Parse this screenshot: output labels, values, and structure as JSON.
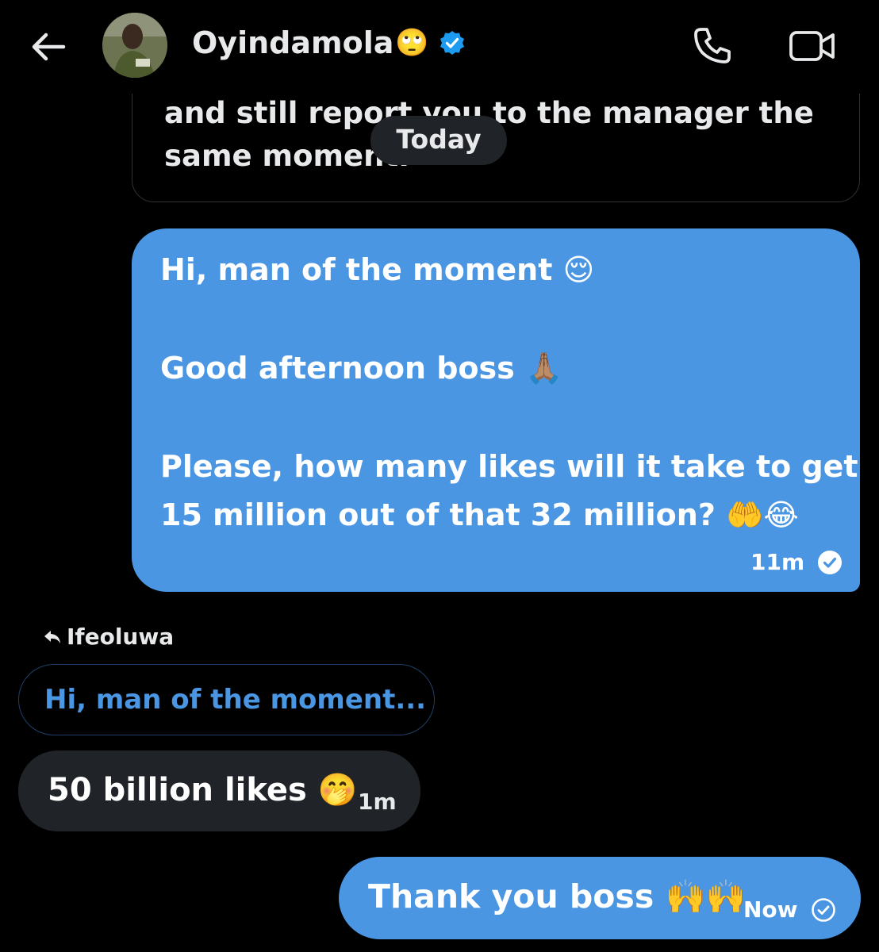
{
  "header": {
    "name": "Oyindamola",
    "name_emoji": "🙄"
  },
  "previous_message": {
    "line1": "and still report you to the manager the",
    "line2": "same moment."
  },
  "date_divider": "Today",
  "messages": [
    {
      "direction": "sent",
      "lines": [
        "Hi, man of the moment 😌",
        "Good afternoon boss 🙏🏽",
        "Please, how many likes will it take to get",
        "15 million out of that 32 million? 🤲😂"
      ],
      "time": "11m",
      "status": "read"
    },
    {
      "direction": "received",
      "reply_to_name": "Ifeoluwa",
      "quoted_text": "Hi, man of the moment...",
      "text": "50 billion likes 🤭",
      "time": "1m"
    },
    {
      "direction": "sent",
      "text": "Thank you boss 🙌🙌",
      "time": "Now",
      "status": "sent"
    }
  ],
  "colors": {
    "background": "#000000",
    "sent_bubble": "#4a96e3",
    "received_bubble": "#202327",
    "quote_text": "#4a96e3",
    "verified": "#1d9bf0"
  }
}
